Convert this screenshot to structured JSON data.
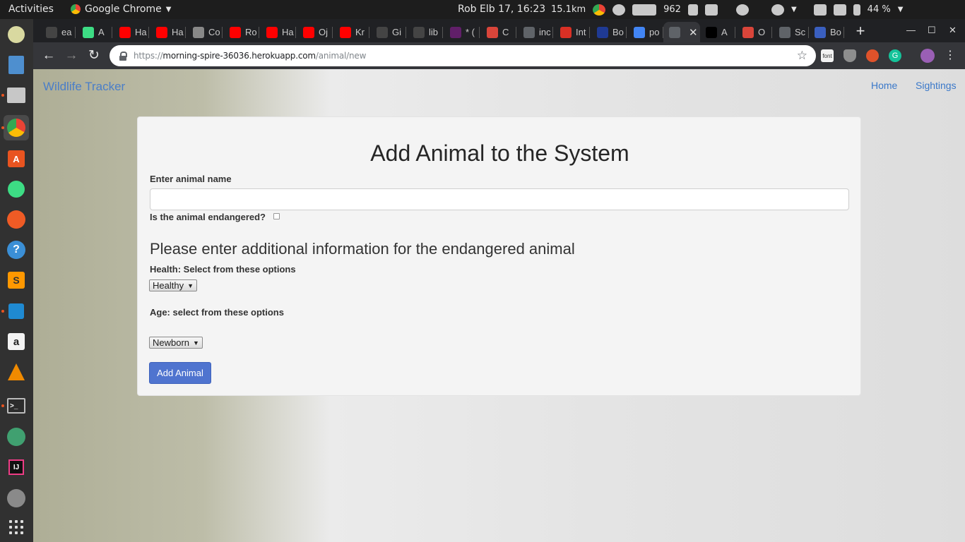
{
  "topbar": {
    "activities": "Activities",
    "app_name": "Google Chrome",
    "clock": "Rob Elb 17, 16:23",
    "net_speed": "15.1km",
    "memory": "962",
    "battery": "44 %"
  },
  "dock": {
    "items": [
      "generic-app-icon",
      "text-editor-icon",
      "files-icon",
      "chrome-icon",
      "software-center-icon",
      "android-studio-icon",
      "postman-icon",
      "help-icon",
      "sublime-text-icon",
      "vscode-icon",
      "amazon-icon",
      "vlc-icon",
      "terminal-icon",
      "atom-icon",
      "intellij-icon",
      "settings-icon"
    ]
  },
  "tabs": [
    {
      "label": "ea",
      "icon": "github-icon"
    },
    {
      "label": "A",
      "icon": "android-icon"
    },
    {
      "label": "Ha",
      "icon": "youtube-icon"
    },
    {
      "label": "Ha",
      "icon": "youtube-icon"
    },
    {
      "label": "Co",
      "icon": "page-icon"
    },
    {
      "label": "Ro",
      "icon": "youtube-icon"
    },
    {
      "label": "Ha",
      "icon": "youtube-icon"
    },
    {
      "label": "Oj",
      "icon": "youtube-icon"
    },
    {
      "label": "Kr",
      "icon": "youtube-icon"
    },
    {
      "label": "Gi",
      "icon": "github-icon"
    },
    {
      "label": "lib",
      "icon": "github-icon"
    },
    {
      "label": "* (",
      "icon": "slack-icon"
    },
    {
      "label": "C",
      "icon": "app-icon"
    },
    {
      "label": "inc",
      "icon": "doc-icon"
    },
    {
      "label": "Int",
      "icon": "gmail-icon"
    },
    {
      "label": "Bo",
      "icon": "mdn-icon"
    },
    {
      "label": "po",
      "icon": "google-icon"
    },
    {
      "label": "",
      "icon": "doc-icon"
    },
    {
      "label": "A",
      "icon": "medium-icon"
    },
    {
      "label": "O",
      "icon": "app-icon"
    },
    {
      "label": "Sc",
      "icon": "doc-icon"
    },
    {
      "label": "Bo",
      "icon": "bootstrap-icon"
    }
  ],
  "address": {
    "scheme": "https://",
    "host": "morning-spire-36036.herokuapp.com",
    "path": "/animal/new"
  },
  "site": {
    "brand": "Wildlife Tracker",
    "nav": [
      "Home",
      "Sightings"
    ]
  },
  "form": {
    "title": "Add Animal to the System",
    "name_label": "Enter animal name",
    "name_value": "",
    "endangered_label": "Is the animal endangered?",
    "endangered_checked": false,
    "subheading": "Please enter additional information for the endangered animal",
    "health_label": "Health: Select from these options",
    "health_selected": "Healthy",
    "age_label": "Age: select from these options",
    "age_selected": "Newborn",
    "submit_label": "Add Animal"
  }
}
